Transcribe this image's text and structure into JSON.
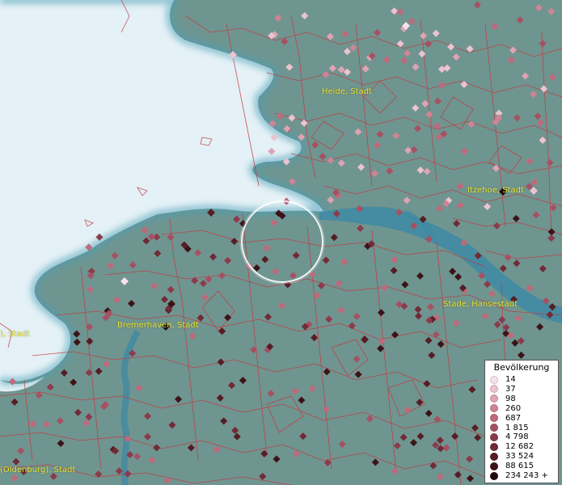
{
  "map": {
    "place_labels": [
      {
        "id": "heide",
        "text": "Heide, Stadt"
      },
      {
        "id": "itzehoe",
        "text": "Itzehoe, Stadt"
      },
      {
        "id": "stade",
        "text": "Stade, Hansestadt"
      },
      {
        "id": "bremerhaven",
        "text": "Bremerhaven, Stadt"
      },
      {
        "id": "cut-stadt",
        "text": "), Stadt"
      },
      {
        "id": "oldenburg",
        "text": "(Oldenburg), Stadt"
      }
    ],
    "colors": {
      "sea": "#e4f1f6",
      "land": "#6f9590",
      "water": "#3e8aa4",
      "borders": "#c6363d",
      "label": "#e8e02a",
      "selection_ring": "#ffffff"
    }
  },
  "legend": {
    "title": "Bevölkerung",
    "entries": [
      {
        "label": "14",
        "color": "#f6e2ec"
      },
      {
        "label": "37",
        "color": "#ecc3d0"
      },
      {
        "label": "98",
        "color": "#dfa3b3"
      },
      {
        "label": "260",
        "color": "#cf8495"
      },
      {
        "label": "687",
        "color": "#bd6a7c"
      },
      {
        "label": "1 815",
        "color": "#a65163"
      },
      {
        "label": "4 798",
        "color": "#8c3b4b"
      },
      {
        "label": "12 682",
        "color": "#712a36"
      },
      {
        "label": "33 524",
        "color": "#561d25"
      },
      {
        "label": "88 615",
        "color": "#3d1318"
      },
      {
        "label": "234 243 +",
        "color": "#200a0c"
      }
    ]
  }
}
